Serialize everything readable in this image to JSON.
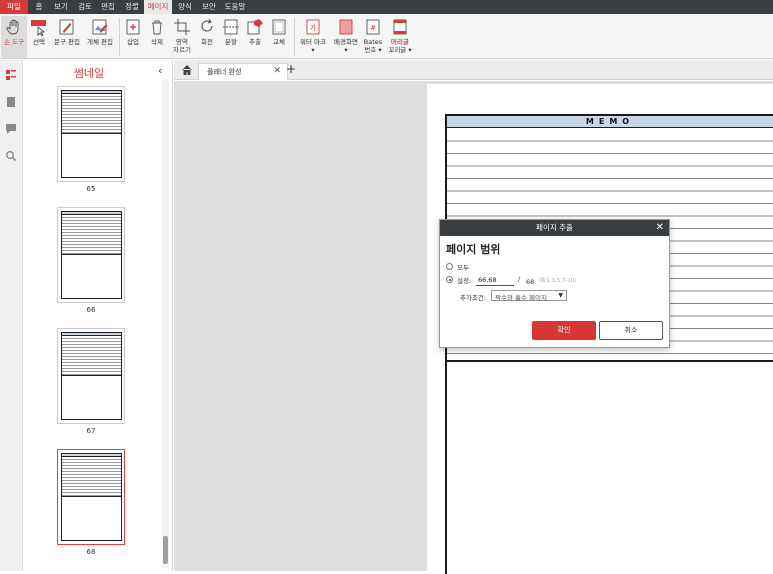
{
  "menubar": {
    "items": [
      "파일",
      "홈",
      "보기",
      "검토",
      "편집",
      "정렬",
      "페이지",
      "양식",
      "보안",
      "도움말"
    ],
    "active": "페이지"
  },
  "ribbon": {
    "buttons": [
      {
        "label": "손 도구",
        "icon": "hand-icon"
      },
      {
        "label": "선택",
        "icon": "select-cursor-icon"
      },
      {
        "label": "문구 편집",
        "icon": "text-edit-icon"
      },
      {
        "label": "개체 편집",
        "icon": "object-edit-icon"
      },
      {
        "label": "삽입",
        "icon": "insert-page-icon"
      },
      {
        "label": "삭제",
        "icon": "trash-icon"
      },
      {
        "label": "영역",
        "label2": "자르기",
        "icon": "crop-icon"
      },
      {
        "label": "회전",
        "icon": "rotate-icon"
      },
      {
        "label": "분할",
        "icon": "split-icon"
      },
      {
        "label": "추출",
        "icon": "extract-icon"
      },
      {
        "label": "교체",
        "icon": "replace-icon"
      },
      {
        "label": "워터 마크",
        "icon": "watermark-icon"
      },
      {
        "label": "배경화면",
        "icon": "background-icon"
      },
      {
        "label": "Bates",
        "label2": "번호",
        "icon": "bates-icon"
      },
      {
        "label": "머리글",
        "label2": "꼬리글",
        "icon": "header-footer-icon"
      }
    ]
  },
  "thumbnails": {
    "title": "썸네일",
    "pages": [
      "65",
      "66",
      "67",
      "68"
    ],
    "selected": "68"
  },
  "tabs": {
    "doc_tab": "플래너 완성"
  },
  "document": {
    "memo_title": "MEMO"
  },
  "dialog": {
    "title": "페이지 추출",
    "heading": "페이지 범위",
    "option_all": "모두",
    "option_set": "설정:",
    "range_value": "66,68",
    "slash": "/",
    "total_pages": "68",
    "hint": "예(1,3,5,7-10)",
    "extra_label": "추가조건:",
    "extra_value": "짝수와 홀수 페이지",
    "ok": "확인",
    "cancel": "취소"
  },
  "colors": {
    "accent": "#d63b3b",
    "menubar": "#3a3d42",
    "memo_header": "#c9d6e6"
  }
}
